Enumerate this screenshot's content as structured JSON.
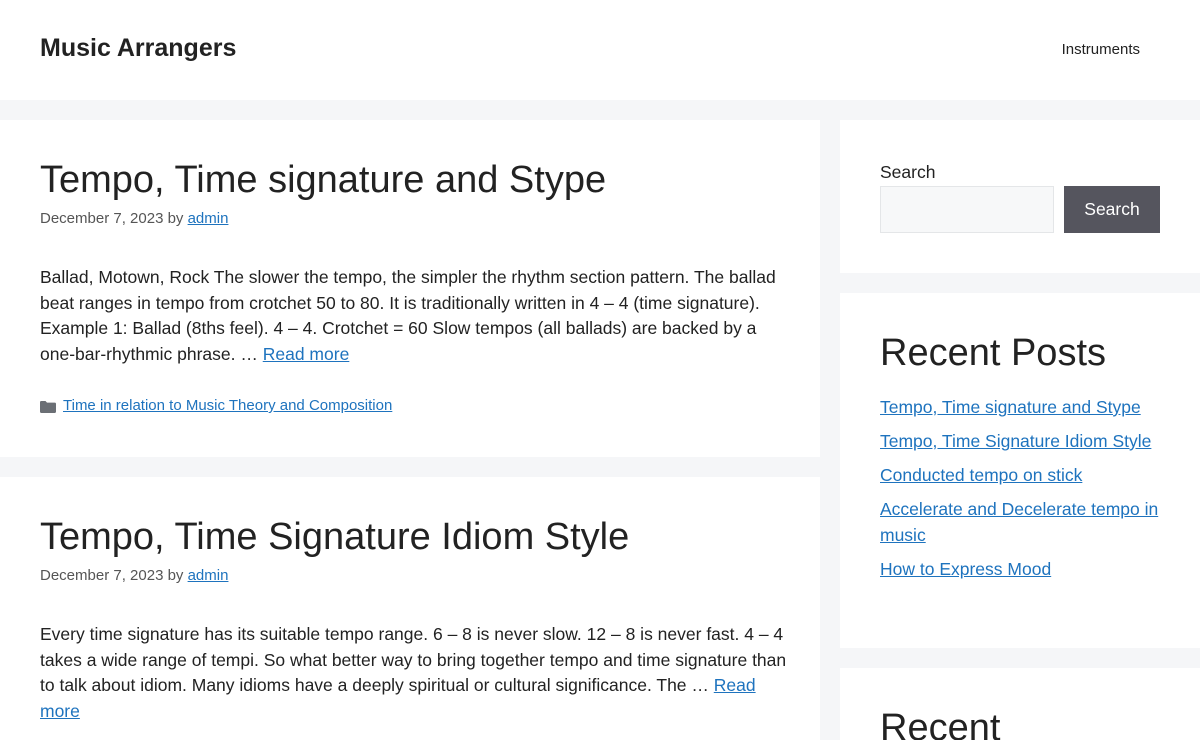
{
  "header": {
    "site_title": "Music Arrangers",
    "nav": [
      "Instruments"
    ]
  },
  "posts": [
    {
      "title": "Tempo, Time signature and Stype",
      "date": "December 7, 2023",
      "by": "by",
      "author": "admin",
      "excerpt": "Ballad, Motown, Rock The slower the tempo, the simpler the rhythm section pattern. The ballad beat ranges in tempo from crotchet 50 to 80. It is traditionally written in 4 – 4 (time signature). Example 1: Ballad (8ths feel). 4 – 4. Crotchet = 60 Slow tempos (all ballads) are backed by a one-bar-rhythmic phrase. … ",
      "read_more": "Read more",
      "category": "Time in relation to Music Theory and Composition"
    },
    {
      "title": "Tempo, Time Signature Idiom Style",
      "date": "December 7, 2023",
      "by": "by",
      "author": "admin",
      "excerpt": "Every time signature has its suitable tempo range. 6 – 8 is never slow. 12 – 8 is never fast. 4 – 4 takes a wide range of tempi. So what better way to bring together tempo and time signature than to talk about idiom. Many idioms have a deeply spiritual or cultural significance. The … ",
      "read_more": "Read more"
    }
  ],
  "sidebar": {
    "search": {
      "label": "Search",
      "placeholder": "",
      "button": "Search"
    },
    "recent_posts": {
      "title": "Recent Posts",
      "items": [
        "Tempo, Time signature and Stype",
        "Tempo, Time Signature Idiom Style",
        "Conducted tempo on stick",
        "Accelerate and Decelerate tempo in music",
        "How to Express Mood"
      ]
    },
    "next_widget_title": "Recent"
  },
  "colors": {
    "link": "#1e73be",
    "background": "#f5f6f8",
    "button": "#55555e"
  }
}
